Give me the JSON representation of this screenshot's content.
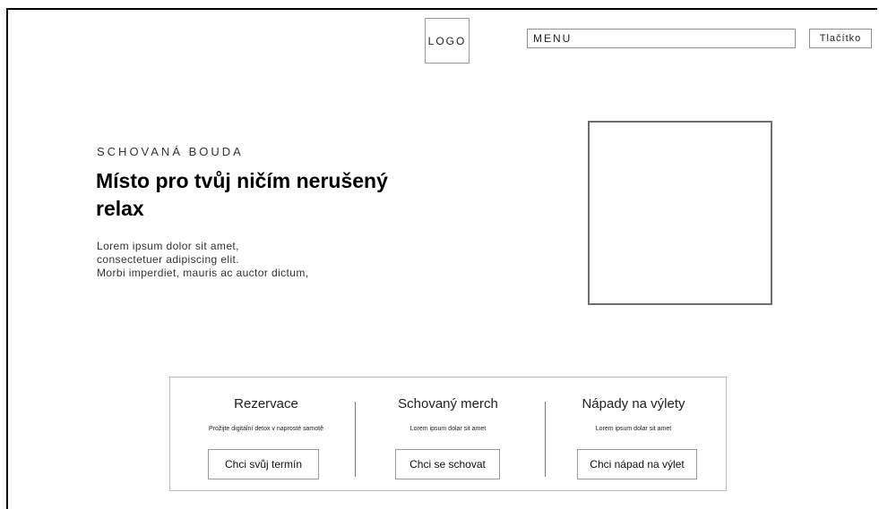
{
  "header": {
    "logo_text": "LOGO",
    "menu_label": "MENU",
    "button_label": "Tlačítko"
  },
  "hero": {
    "eyebrow": "SCHOVANÁ BOUDA",
    "title": "Místo pro tvůj ničím nerušený relax",
    "description_lines": [
      "Lorem ipsum dolor sit amet,",
      "consectetuer adipiscing elit.",
      "Morbi imperdiet, mauris ac auctor dictum,"
    ]
  },
  "features": [
    {
      "title": "Rezervace",
      "text": "Prožijte digitální detox v naprosté samotě",
      "button": "Chci svůj termín"
    },
    {
      "title": "Schovaný merch",
      "text": "Lorem ipsum dolar sit amet",
      "button": "Chci se schovat"
    },
    {
      "title": "Nápady na výlety",
      "text": "Lorem ipsum dolar sit amet",
      "button": "Chci nápad na výlet"
    }
  ]
}
